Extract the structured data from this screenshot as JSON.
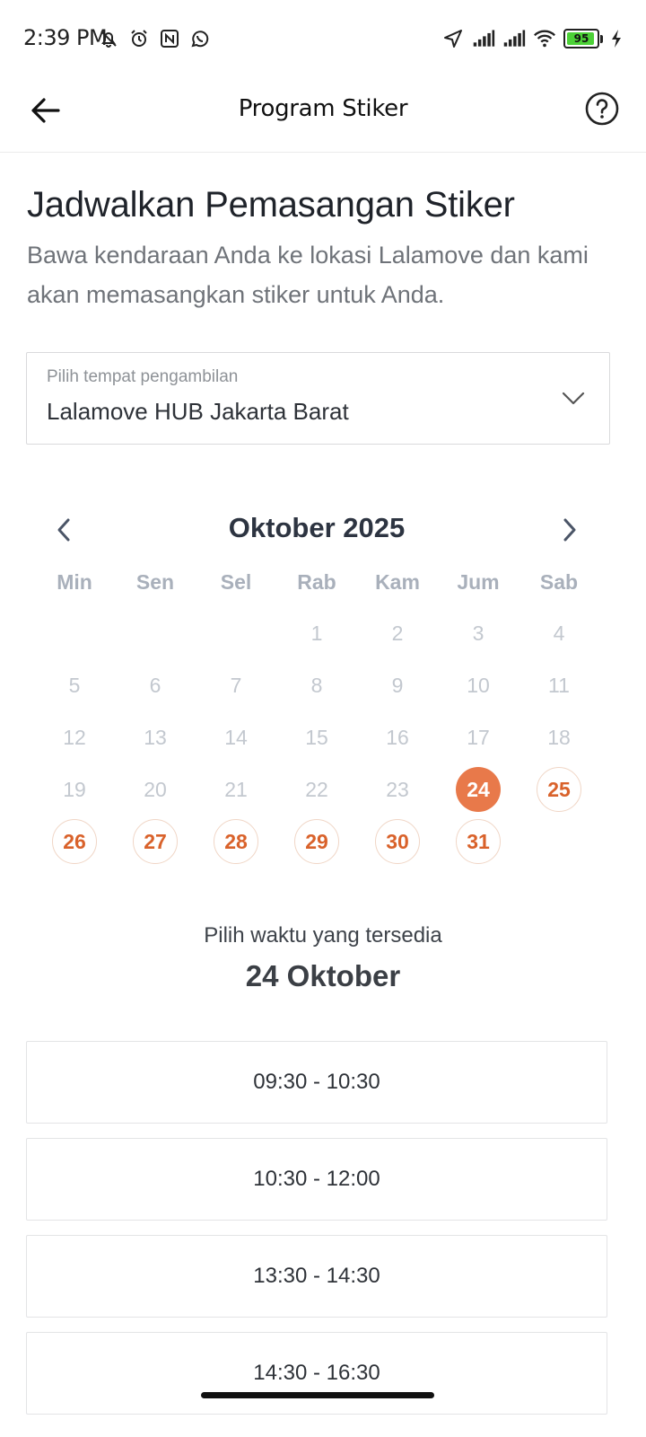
{
  "status_bar": {
    "time": "2:39 PM",
    "battery_level": 95,
    "battery_label": "95",
    "icons_left": [
      "mute-bell-icon",
      "alarm-icon",
      "nfc-icon",
      "whatsapp-icon"
    ],
    "icons_right": [
      "location-arrow-icon",
      "signal-icon",
      "signal-icon",
      "wifi-icon",
      "battery-icon",
      "charging-icon"
    ]
  },
  "header": {
    "title": "Program Stiker",
    "back_icon": "arrow-left-icon",
    "help_icon": "question-circle-icon"
  },
  "main": {
    "heading": "Jadwalkan Pemasangan Stiker",
    "description": "Bawa kendaraan Anda ke lokasi Lalamove dan kami akan memasangkan stiker untuk Anda."
  },
  "pickup": {
    "label": "Pilih tempat pengambilan",
    "value": "Lalamove HUB Jakarta Barat"
  },
  "calendar": {
    "month_label": "Oktober 2025",
    "weekdays": [
      "Min",
      "Sen",
      "Sel",
      "Rab",
      "Kam",
      "Jum",
      "Sab"
    ],
    "first_weekday_index": 3,
    "days_in_month": 31,
    "available_days": [
      24,
      25,
      26,
      27,
      28,
      29,
      30,
      31
    ],
    "selected_day": 24
  },
  "time_selection": {
    "caption": "Pilih waktu yang tersedia",
    "selected_date": "24 Oktober",
    "slots": [
      "09:30 - 10:30",
      "10:30 - 12:00",
      "13:30 - 14:30",
      "14:30 - 16:30"
    ]
  },
  "colors": {
    "accent": "#e8794a",
    "accent_text": "#d9622b",
    "disabled_text": "#c3c8cf"
  }
}
